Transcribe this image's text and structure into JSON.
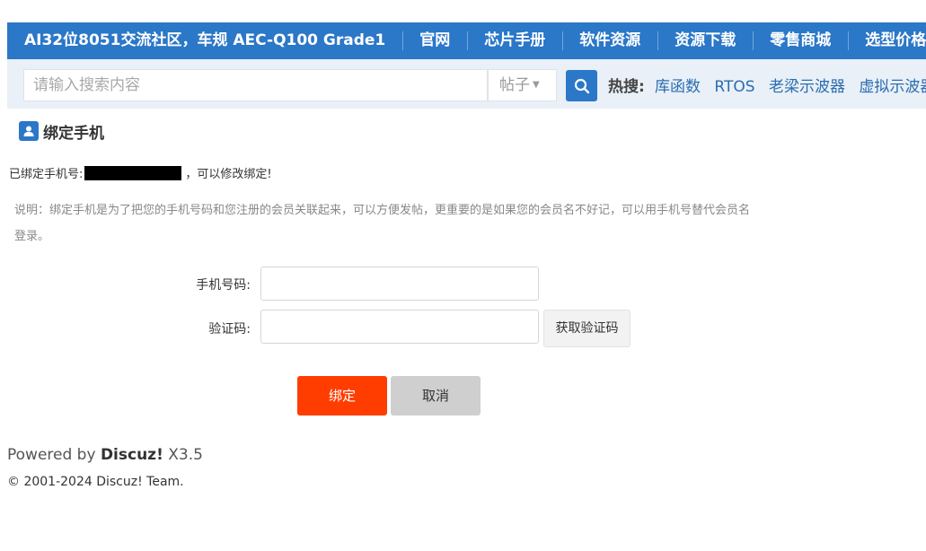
{
  "nav": {
    "items": [
      "AI32位8051交流社区，车规 AEC-Q100 Grade1",
      "官网",
      "芯片手册",
      "软件资源",
      "资源下载",
      "零售商城",
      "选型价格"
    ]
  },
  "search": {
    "placeholder": "请输入搜索内容",
    "type_label": "帖子",
    "hot_label": "热搜:",
    "hot_links": [
      "库函数",
      "RTOS",
      "老梁示波器",
      "虚拟示波器"
    ]
  },
  "page": {
    "title": "绑定手机",
    "bound_prefix": "已绑定手机号:",
    "bound_suffix": "，可以修改绑定!",
    "note": "说明：绑定手机是为了把您的手机号码和您注册的会员关联起来，可以方便发帖，更重要的是如果您的会员名不好记，可以用手机号替代会员名登录。"
  },
  "form": {
    "phone_label": "手机号码:",
    "phone_value": "",
    "code_label": "验证码:",
    "code_value": "",
    "get_code_label": "获取验证码",
    "bind_label": "绑定",
    "cancel_label": "取消"
  },
  "footer": {
    "powered_prefix": "Powered by ",
    "powered_brand": "Discuz!",
    "powered_version": " X3.5",
    "copyright": "© 2001-2024 Discuz! Team."
  },
  "colors": {
    "primary": "#2b77c8",
    "danger": "#ff3d00",
    "muted": "#888888"
  }
}
